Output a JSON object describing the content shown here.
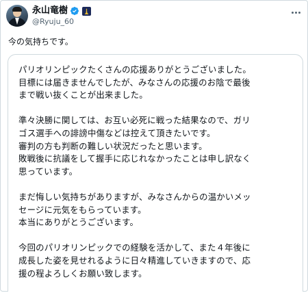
{
  "user": {
    "display_name": "永山竜樹",
    "handle": "@Ryuju_60",
    "verified_color": "#1d9bf0",
    "icons": [
      "verified-badge-icon",
      "affiliation-badge-icon",
      "more-options-icon"
    ]
  },
  "tweet": {
    "text": "今の気持ちです。"
  },
  "image": {
    "paragraphs": [
      [
        "パリオリンピックたくさんの応援ありがとうございました。",
        "目標には届きませんでしたが、みなさんの応援のお陰で最後",
        "まで戦い抜くことが出来ました。"
      ],
      [
        "準々決勝に関しては、お互い必死に戦った結果なので、ガリ",
        "ゴス選手への誹謗中傷などは控えて頂きたいです。",
        "審判の方も判断の難しい状況だったと思います。",
        "敗戦後に抗議をして握手に応じれなかったことは申し訳なく",
        "思っています。"
      ],
      [
        "まだ悔しい気持ちがありますが、みなさんからの温かいメッ",
        "セージに元気をもらっています。",
        "本当にありがとうございます。"
      ],
      [
        "今回のパリオリンピックでの経験を活かして、また４年後に",
        "成長した姿を見せれるように日々精進していきますので、応",
        "援の程よろしくお願い致します。"
      ]
    ]
  }
}
